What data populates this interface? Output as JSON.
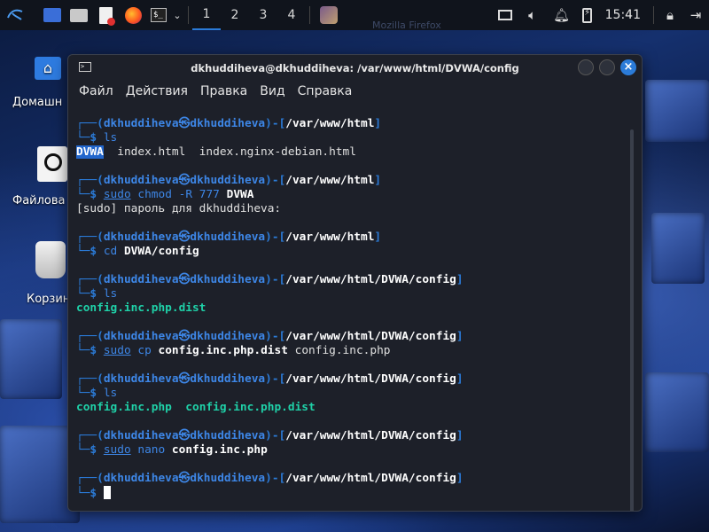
{
  "taskbar": {
    "workspaces": [
      "1",
      "2",
      "3",
      "4"
    ],
    "clock": "15:41",
    "background_window": "Mozilla Firefox"
  },
  "desktop": {
    "home_label": "Домашн",
    "files_label": "Файлова",
    "trash_label": "Корзин"
  },
  "window": {
    "title": "dkhuddiheva@dkhuddiheva: /var/www/html/DVWA/config",
    "menu": [
      "Файл",
      "Действия",
      "Правка",
      "Вид",
      "Справка"
    ]
  },
  "terminal": {
    "user": "dkhuddiheva",
    "blocks": [
      {
        "path": "/var/www/html",
        "cmd": "ls",
        "output": [
          "DVWA",
          "index.html",
          "index.nginx-debian.html"
        ]
      },
      {
        "path": "/var/www/html",
        "cmd": "sudo chmod -R 777 DVWA",
        "output": [
          "[sudo] пароль для dkhuddiheva:"
        ]
      },
      {
        "path": "/var/www/html",
        "cmd": "cd DVWA/config"
      },
      {
        "path": "/var/www/html/DVWA/config",
        "cmd": "ls",
        "output": [
          "config.inc.php.dist"
        ]
      },
      {
        "path": "/var/www/html/DVWA/config",
        "cmd": "sudo cp config.inc.php.dist config.inc.php"
      },
      {
        "path": "/var/www/html/DVWA/config",
        "cmd": "ls",
        "output": [
          "config.inc.php",
          "config.inc.php.dist"
        ]
      },
      {
        "path": "/var/www/html/DVWA/config",
        "cmd": "sudo nano config.inc.php"
      },
      {
        "path": "/var/www/html/DVWA/config",
        "cmd": ""
      }
    ]
  },
  "colors": {
    "accent": "#2b7bd8",
    "terminal_bg": "#1d2029",
    "taskbar_bg": "#10141c",
    "green": "#1fd1a8"
  }
}
